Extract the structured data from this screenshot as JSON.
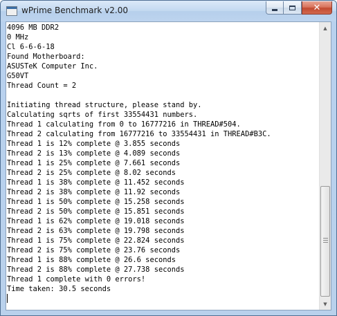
{
  "window": {
    "title": "wPrime Benchmark v2.00",
    "icon": "app-window-icon",
    "controls": {
      "minimize": "minimize-icon",
      "maximize": "maximize-icon",
      "close": "close-icon",
      "close_glyph": "✕"
    },
    "accent_color": "#c24a31"
  },
  "console": {
    "lines": [
      "4096 MB DDR2",
      "0 MHz",
      "Cl 6-6-6-18",
      "Found Motherboard:",
      "ASUSTeK Computer Inc.",
      "G50VT",
      "Thread Count = 2",
      "",
      "Initiating thread structure, please stand by.",
      "Calculating sqrts of first 33554431 numbers.",
      "Thread 1 calculating from 0 to 16777216 in THREAD#504.",
      "Thread 2 calculating from 16777216 to 33554431 in THREAD#B3C.",
      "Thread 1 is 12% complete @ 3.855 seconds",
      "Thread 2 is 13% complete @ 4.089 seconds",
      "Thread 1 is 25% complete @ 7.661 seconds",
      "Thread 2 is 25% complete @ 8.02 seconds",
      "Thread 1 is 38% complete @ 11.452 seconds",
      "Thread 2 is 38% complete @ 11.92 seconds",
      "Thread 1 is 50% complete @ 15.258 seconds",
      "Thread 2 is 50% complete @ 15.851 seconds",
      "Thread 1 is 62% complete @ 19.018 seconds",
      "Thread 2 is 63% complete @ 19.798 seconds",
      "Thread 1 is 75% complete @ 22.824 seconds",
      "Thread 2 is 75% complete @ 23.76 seconds",
      "Thread 1 is 88% complete @ 26.6 seconds",
      "Thread 2 is 88% complete @ 27.738 seconds",
      "Thread 1 complete with 0 errors!",
      "Time taken: 30.5 seconds"
    ]
  },
  "scrollbar": {
    "up_glyph": "▲",
    "down_glyph": "▼",
    "position": 0.93
  }
}
